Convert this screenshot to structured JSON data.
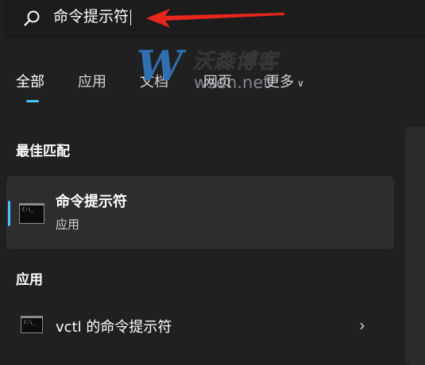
{
  "search": {
    "query": "命令提示符"
  },
  "watermark": {
    "letter": "W",
    "brand": "沃森博客",
    "url": "wsen.net"
  },
  "tabs": [
    {
      "label": "全部",
      "active": true
    },
    {
      "label": "应用"
    },
    {
      "label": "文档"
    },
    {
      "label": "网页"
    },
    {
      "label": "更多"
    }
  ],
  "best_match": {
    "section_title": "最佳匹配",
    "title": "命令提示符",
    "subtitle": "应用",
    "icon_text": "C:\\_"
  },
  "apps": {
    "section_title": "应用",
    "items": [
      {
        "label": "vctl 的命令提示符",
        "icon_text": "C:\\_"
      }
    ]
  },
  "colors": {
    "accent": "#4cc2ff",
    "background": "#202020",
    "card": "#2d2d2d",
    "arrow": "#e8261c",
    "watermark_blue": "#2f6fb3"
  },
  "icons": {
    "search": "search-icon",
    "more_chevron": "chevron-down-icon",
    "row_chevron": "chevron-right-icon",
    "app": "command-prompt-icon"
  }
}
